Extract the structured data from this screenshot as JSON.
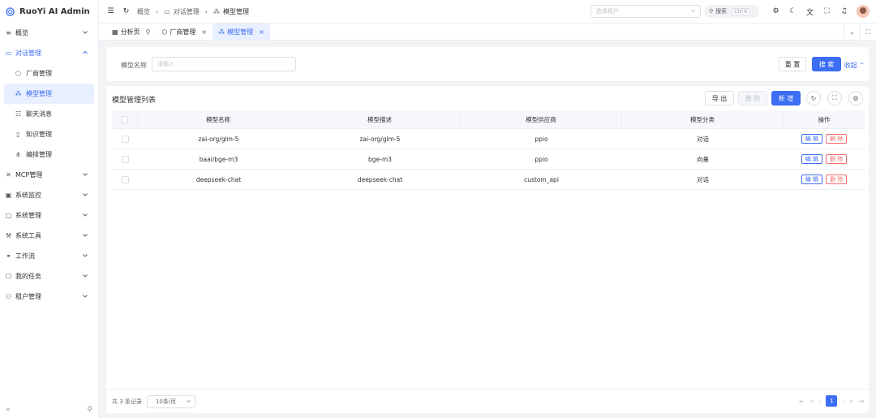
{
  "app": {
    "title": "RuoYi AI Admin"
  },
  "sidebar": {
    "items": [
      {
        "label": "概览",
        "icon": "list-icon"
      },
      {
        "label": "对话管理",
        "icon": "chat-icon"
      },
      {
        "label": "MCP管理",
        "icon": "mcp-icon"
      },
      {
        "label": "系统监控",
        "icon": "monitor-icon"
      },
      {
        "label": "系统管理",
        "icon": "system-icon"
      },
      {
        "label": "系统工具",
        "icon": "tool-icon"
      },
      {
        "label": "工作流",
        "icon": "workflow-icon"
      },
      {
        "label": "我的任务",
        "icon": "task-icon"
      },
      {
        "label": "租户管理",
        "icon": "tenant-icon"
      }
    ],
    "sub_items": [
      {
        "label": "厂商管理",
        "icon": "cube-icon"
      },
      {
        "label": "模型管理",
        "icon": "model-icon"
      },
      {
        "label": "聊天消息",
        "icon": "message-icon"
      },
      {
        "label": "知识管理",
        "icon": "book-icon"
      },
      {
        "label": "编排管理",
        "icon": "flow-icon"
      }
    ]
  },
  "header": {
    "breadcrumb": [
      "概览",
      "对话管理",
      "模型管理"
    ],
    "tenant_placeholder": "选择租户",
    "search_label": "搜索",
    "search_kbd": "Ctrl K"
  },
  "tabs": [
    {
      "label": "分析页",
      "pinned": true
    },
    {
      "label": "厂商管理"
    },
    {
      "label": "模型管理",
      "active": true
    }
  ],
  "search_form": {
    "label": "模型名称",
    "placeholder": "请输入",
    "reset": "重 置",
    "search": "搜 索",
    "collapse": "收起"
  },
  "list": {
    "title": "模型管理列表",
    "export": "导 出",
    "delete": "删 除",
    "add": "新 增",
    "columns": [
      "模型名称",
      "模型描述",
      "模型供应商",
      "模型分类",
      "操作"
    ],
    "rows": [
      {
        "name": "zai-org/glm-5",
        "desc": "zai-org/glm-5",
        "vendor": "ppio",
        "category": "对话"
      },
      {
        "name": "baai/bge-m3",
        "desc": "bge-m3",
        "vendor": "ppio",
        "category": "向量"
      },
      {
        "name": "deepseek-chat",
        "desc": "deepseek-chat",
        "vendor": "custom_api",
        "category": "对话"
      }
    ],
    "edit": "编 辑",
    "remove": "删 除"
  },
  "pagination": {
    "total": "共 3 条记录",
    "page_size": "10条/页",
    "current": "1"
  },
  "colors": {
    "primary": "#3b6df5",
    "danger": "#f56c6c"
  }
}
